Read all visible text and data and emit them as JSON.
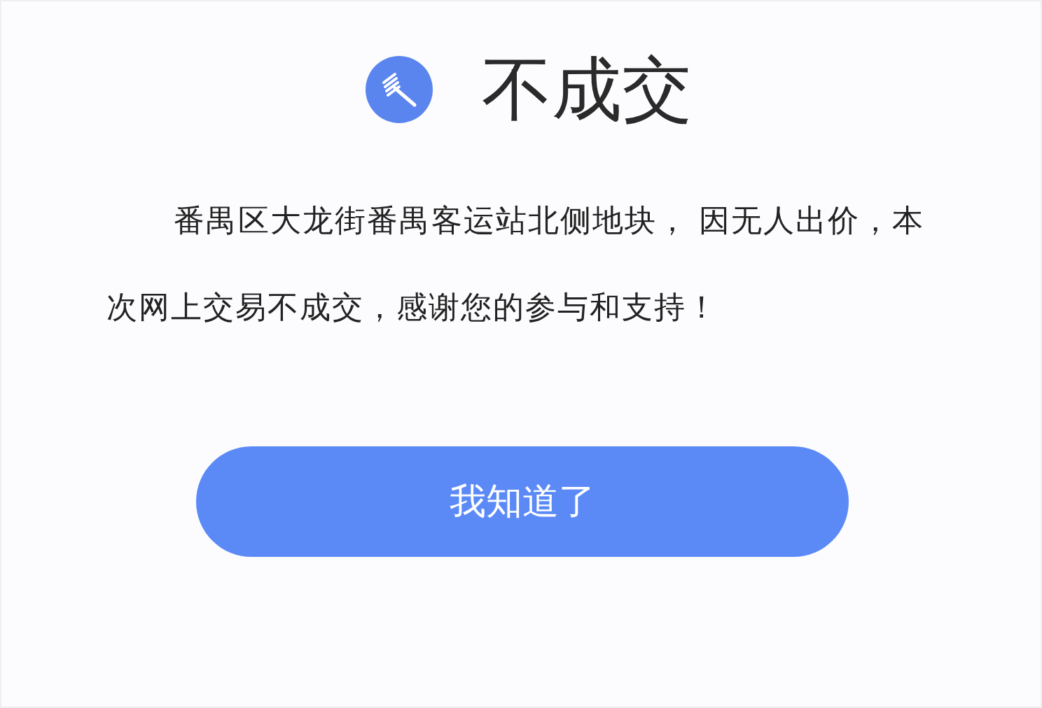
{
  "dialog": {
    "title": "不成交",
    "message": "番禺区大龙街番禺客运站北侧地块， 因无人出价，本次网上交易不成交，感谢您的参与和支持！",
    "button": "我知道了"
  }
}
